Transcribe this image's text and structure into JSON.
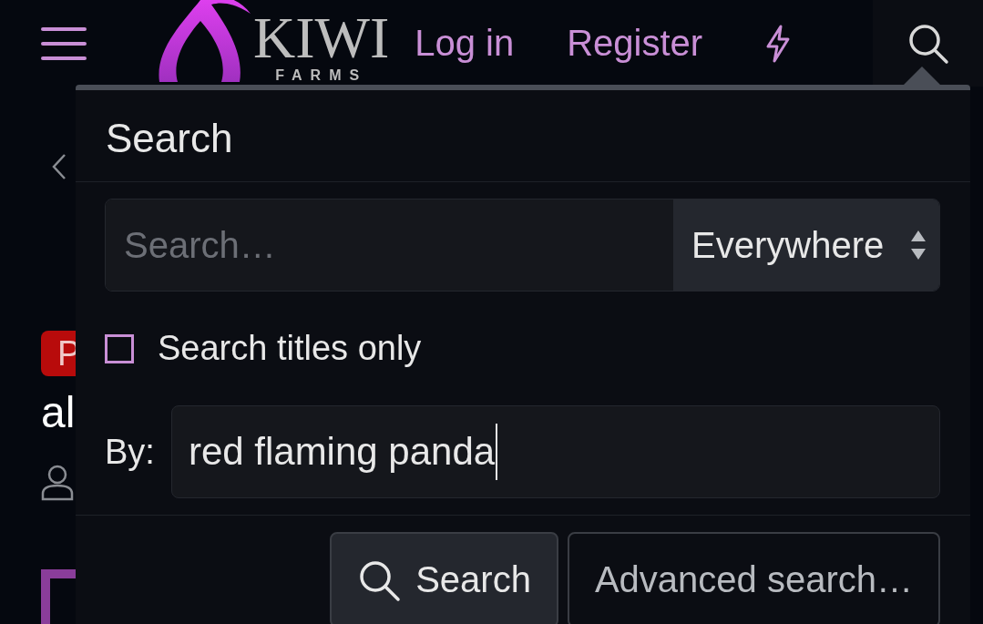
{
  "header": {
    "logo": {
      "word": "KIWI",
      "sub": "FARMS"
    },
    "links": [
      {
        "label": "Log in"
      },
      {
        "label": "Register"
      }
    ]
  },
  "background": {
    "badge": "P",
    "title_fragment": "al"
  },
  "search_menu": {
    "title": "Search",
    "query": {
      "placeholder": "Search…"
    },
    "scope": {
      "value": "Everywhere"
    },
    "titles_only": {
      "label": "Search titles only",
      "checked": false
    },
    "by": {
      "label": "By:",
      "value": "red flaming panda"
    },
    "buttons": [
      {
        "label": "Search",
        "kind": "primary"
      },
      {
        "label": "Advanced search…",
        "kind": "secondary"
      }
    ]
  }
}
